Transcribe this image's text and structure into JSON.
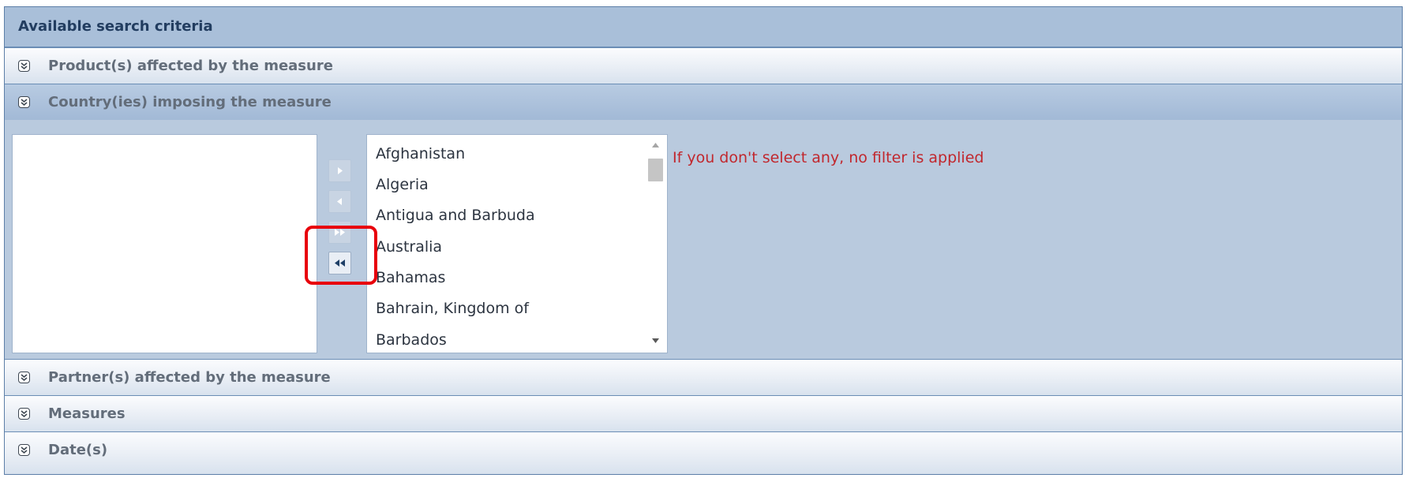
{
  "panel": {
    "title": "Available search criteria"
  },
  "sections": [
    {
      "label": "Product(s) affected by the measure",
      "state": "collapsed"
    },
    {
      "label": "Country(ies) imposing the measure",
      "state": "expanded"
    },
    {
      "label": "Partner(s) affected by the measure",
      "state": "collapsed"
    },
    {
      "label": "Measures",
      "state": "collapsed"
    },
    {
      "label": "Date(s)",
      "state": "collapsed"
    }
  ],
  "country_selector": {
    "available_countries": [
      "Afghanistan",
      "Algeria",
      "Antigua and Barbuda",
      "Australia",
      "Bahamas",
      "Bahrain, Kingdom of",
      "Barbados"
    ],
    "selected_countries": [],
    "hint": "If you don't select any, no filter is applied",
    "buttons": [
      {
        "name": "move-selected-right",
        "enabled": false
      },
      {
        "name": "move-selected-left",
        "enabled": false
      },
      {
        "name": "move-all-right",
        "enabled": false
      },
      {
        "name": "move-all-left",
        "enabled": true
      }
    ]
  },
  "colors": {
    "hint": "#c1272d",
    "highlight": "#e8000b",
    "header": "#223d60"
  }
}
